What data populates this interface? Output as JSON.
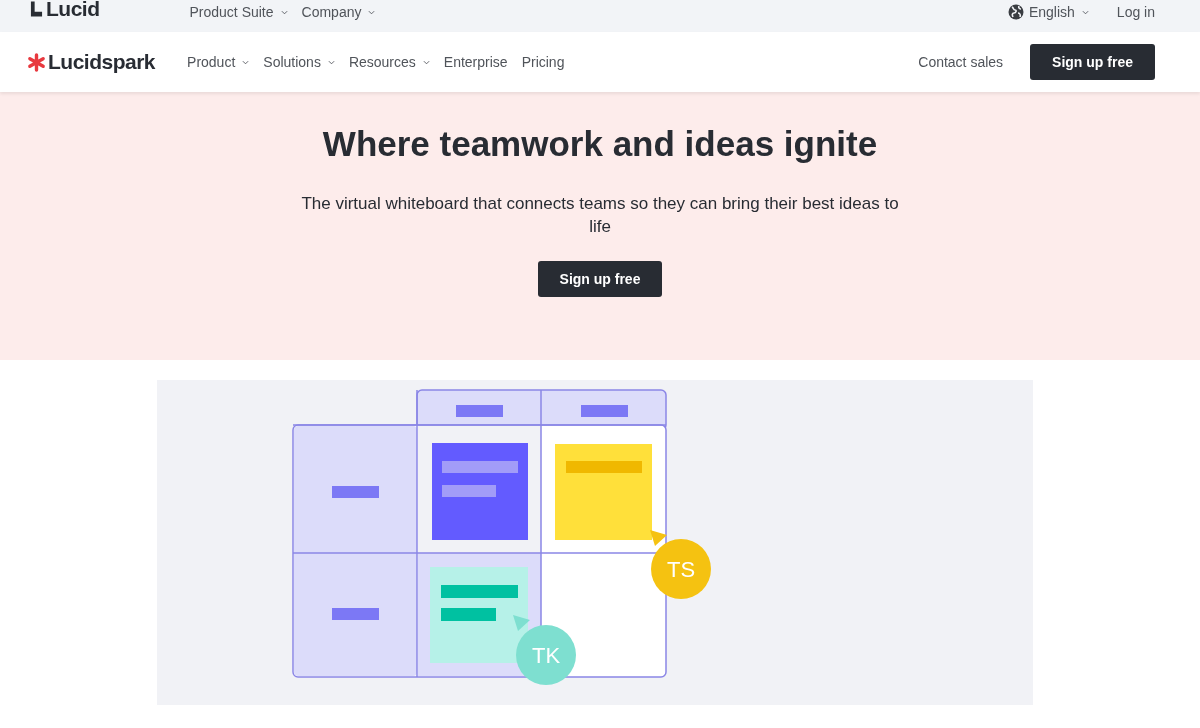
{
  "top_bar": {
    "logo": "Lucid",
    "menu": [
      {
        "label": "Product Suite",
        "dropdown": true
      },
      {
        "label": "Company",
        "dropdown": true
      }
    ],
    "language": {
      "label": "English",
      "dropdown": true
    },
    "login": "Log in"
  },
  "nav": {
    "logo": "Lucidspark",
    "menu": [
      {
        "label": "Product",
        "dropdown": true
      },
      {
        "label": "Solutions",
        "dropdown": true
      },
      {
        "label": "Resources",
        "dropdown": true
      },
      {
        "label": "Enterprise",
        "dropdown": false
      },
      {
        "label": "Pricing",
        "dropdown": false
      }
    ],
    "contact": "Contact sales",
    "cta": "Sign up free"
  },
  "hero": {
    "title": "Where teamwork and ideas ignite",
    "subtitle": "The virtual whiteboard that connects teams so they can bring their best ideas to life",
    "cta": "Sign up free"
  },
  "illustration": {
    "avatars": [
      {
        "initials": "TS",
        "color": "#f5c211"
      },
      {
        "initials": "TK",
        "color": "#7edfd0"
      }
    ]
  }
}
